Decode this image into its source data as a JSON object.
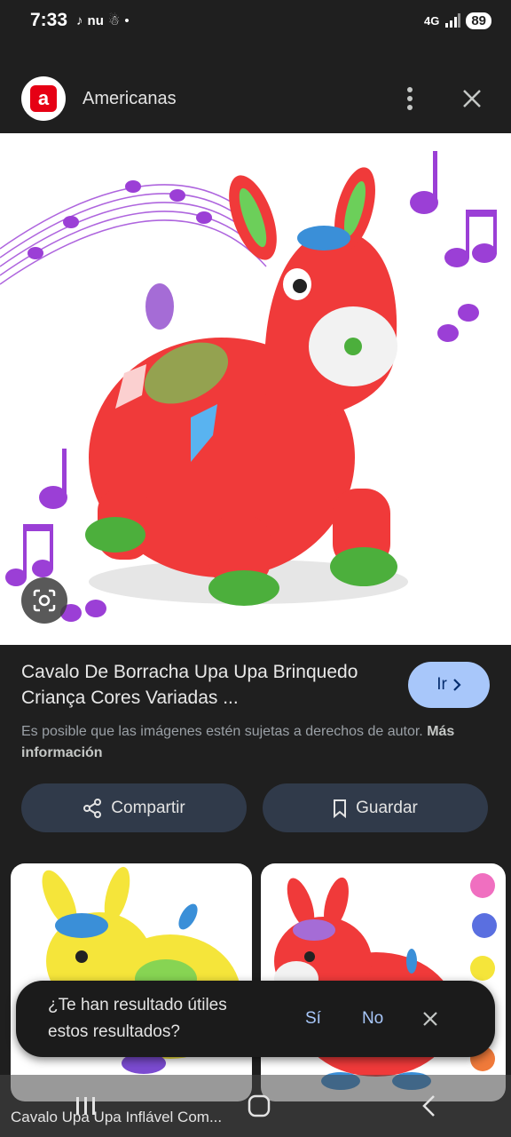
{
  "status_bar": {
    "time": "7:33",
    "app1": "♪",
    "app2": "nu",
    "app3": "☃",
    "dot": "•",
    "network": "4G",
    "battery": "89"
  },
  "header": {
    "site_logo_letter": "a",
    "site_name": "Americanas"
  },
  "result": {
    "title": "Cavalo De Borracha Upa Upa Brinquedo Criança Cores Variadas ...",
    "go_button": "Ir",
    "rights_text": "Es posible que las imágenes estén sujetas a derechos de autor.",
    "more_info": "Más información"
  },
  "actions": {
    "share_label": "Compartir",
    "save_label": "Guardar"
  },
  "feedback": {
    "question": "¿Te han resultado útiles estos resultados?",
    "yes": "Sí",
    "no": "No"
  },
  "related": {
    "caption": "Cavalo Upa Upa Inflável Com..."
  },
  "colors": {
    "accent": "#a8c7fa",
    "brand": "#e60014",
    "toy_red": "#f03a3a",
    "music_note": "#9b3fd6"
  }
}
